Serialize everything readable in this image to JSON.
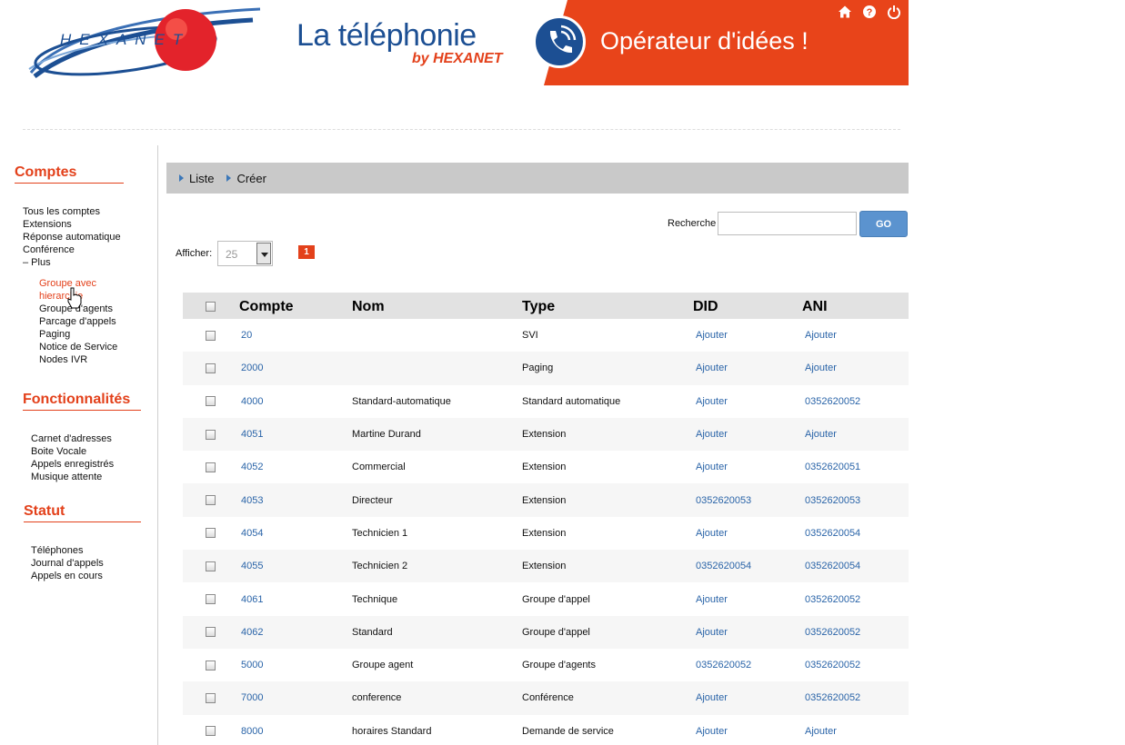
{
  "header": {
    "logo_text": "HEXANET",
    "tagline": "La téléphonie",
    "tagline_sub": "by HEXANET",
    "slogan": "Opérateur d'idées !",
    "icons": [
      "home-icon",
      "help-icon",
      "power-icon"
    ]
  },
  "colors": {
    "accent": "#e3411b",
    "brand_blue": "#1c4f93",
    "link": "#2a64a8",
    "go_button": "#5b93cf"
  },
  "sidebar": {
    "comptes": {
      "title": "Comptes",
      "items": [
        "Tous les comptes",
        "Extensions",
        "Réponse automatique",
        "Conférence",
        "– Plus"
      ],
      "sub_items": [
        "Groupe avec hierarchie",
        "Groupe d'agents",
        "Parcage d'appels",
        "Paging",
        "Notice de Service",
        "Nodes IVR"
      ]
    },
    "fonctionnalites": {
      "title": "Fonctionnalités",
      "items": [
        "Carnet d'adresses",
        "Boite Vocale",
        "Appels enregistrés",
        "Musique attente"
      ]
    },
    "statut": {
      "title": "Statut",
      "items": [
        "Téléphones",
        "Journal d'appels",
        "Appels en cours"
      ]
    }
  },
  "tabs": [
    "Liste",
    "Créer"
  ],
  "search": {
    "label": "Recherche",
    "value": "",
    "button": "GO"
  },
  "pagination": {
    "show_label": "Afficher:",
    "page_size": "25",
    "current_page": "1"
  },
  "table": {
    "columns": [
      "Compte",
      "Nom",
      "Type",
      "DID",
      "ANI"
    ],
    "rows": [
      {
        "compte": "20",
        "nom": "",
        "type": "SVI",
        "did": "Ajouter",
        "ani": "Ajouter"
      },
      {
        "compte": "2000",
        "nom": "",
        "type": "Paging",
        "did": "Ajouter",
        "ani": "Ajouter"
      },
      {
        "compte": "4000",
        "nom": "Standard-automatique",
        "type": "Standard automatique",
        "did": "Ajouter",
        "ani": "0352620052"
      },
      {
        "compte": "4051",
        "nom": "Martine Durand",
        "type": "Extension",
        "did": "Ajouter",
        "ani": "Ajouter"
      },
      {
        "compte": "4052",
        "nom": "Commercial",
        "type": "Extension",
        "did": "Ajouter",
        "ani": "0352620051"
      },
      {
        "compte": "4053",
        "nom": "Directeur",
        "type": "Extension",
        "did": "0352620053",
        "ani": "0352620053"
      },
      {
        "compte": "4054",
        "nom": "Technicien 1",
        "type": "Extension",
        "did": "Ajouter",
        "ani": "0352620054"
      },
      {
        "compte": "4055",
        "nom": "Technicien 2",
        "type": "Extension",
        "did": "0352620054",
        "ani": "0352620054"
      },
      {
        "compte": "4061",
        "nom": "Technique",
        "type": "Groupe d'appel",
        "did": "Ajouter",
        "ani": "0352620052"
      },
      {
        "compte": "4062",
        "nom": "Standard",
        "type": "Groupe d'appel",
        "did": "Ajouter",
        "ani": "0352620052"
      },
      {
        "compte": "5000",
        "nom": "Groupe agent",
        "type": "Groupe d'agents",
        "did": "0352620052",
        "ani": "0352620052"
      },
      {
        "compte": "7000",
        "nom": "conference",
        "type": "Conférence",
        "did": "Ajouter",
        "ani": "0352620052"
      },
      {
        "compte": "8000",
        "nom": "horaires Standard",
        "type": "Demande de service",
        "did": "Ajouter",
        "ani": "Ajouter"
      }
    ]
  }
}
